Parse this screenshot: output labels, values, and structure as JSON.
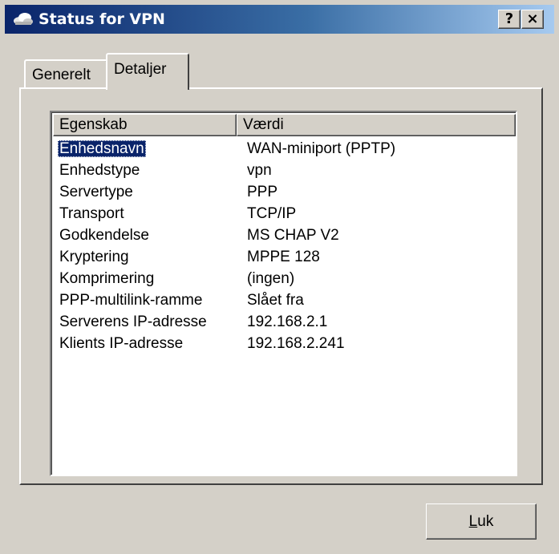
{
  "window": {
    "title": "Status for VPN",
    "help_button": "?",
    "close_button": "×"
  },
  "tabs": [
    {
      "label": "Generelt",
      "selected": false
    },
    {
      "label": "Detaljer",
      "selected": true
    }
  ],
  "details": {
    "columns": {
      "property": "Egenskab",
      "value": "Værdi"
    },
    "rows": [
      {
        "property": "Enhedsnavn",
        "value": "WAN-miniport (PPTP)"
      },
      {
        "property": "Enhedstype",
        "value": "vpn"
      },
      {
        "property": "Servertype",
        "value": "PPP"
      },
      {
        "property": "Transport",
        "value": "TCP/IP"
      },
      {
        "property": "Godkendelse",
        "value": "MS CHAP V2"
      },
      {
        "property": "Kryptering",
        "value": "MPPE 128"
      },
      {
        "property": "Komprimering",
        "value": "(ingen)"
      },
      {
        "property": "PPP-multilink-ramme",
        "value": "Slået fra"
      },
      {
        "property": "Serverens IP-adresse",
        "value": "192.168.2.1"
      },
      {
        "property": "Klients IP-adresse",
        "value": "192.168.2.241"
      }
    ],
    "selected_row": 0
  },
  "footer": {
    "close_label_underlined": "L",
    "close_label_rest": "uk"
  },
  "colors": {
    "titlebar_start": "#0a246a",
    "titlebar_end": "#a6caf0",
    "face": "#d4d0c8",
    "selection": "#0a246a"
  },
  "icons": {
    "title": "network-cloud-icon"
  }
}
